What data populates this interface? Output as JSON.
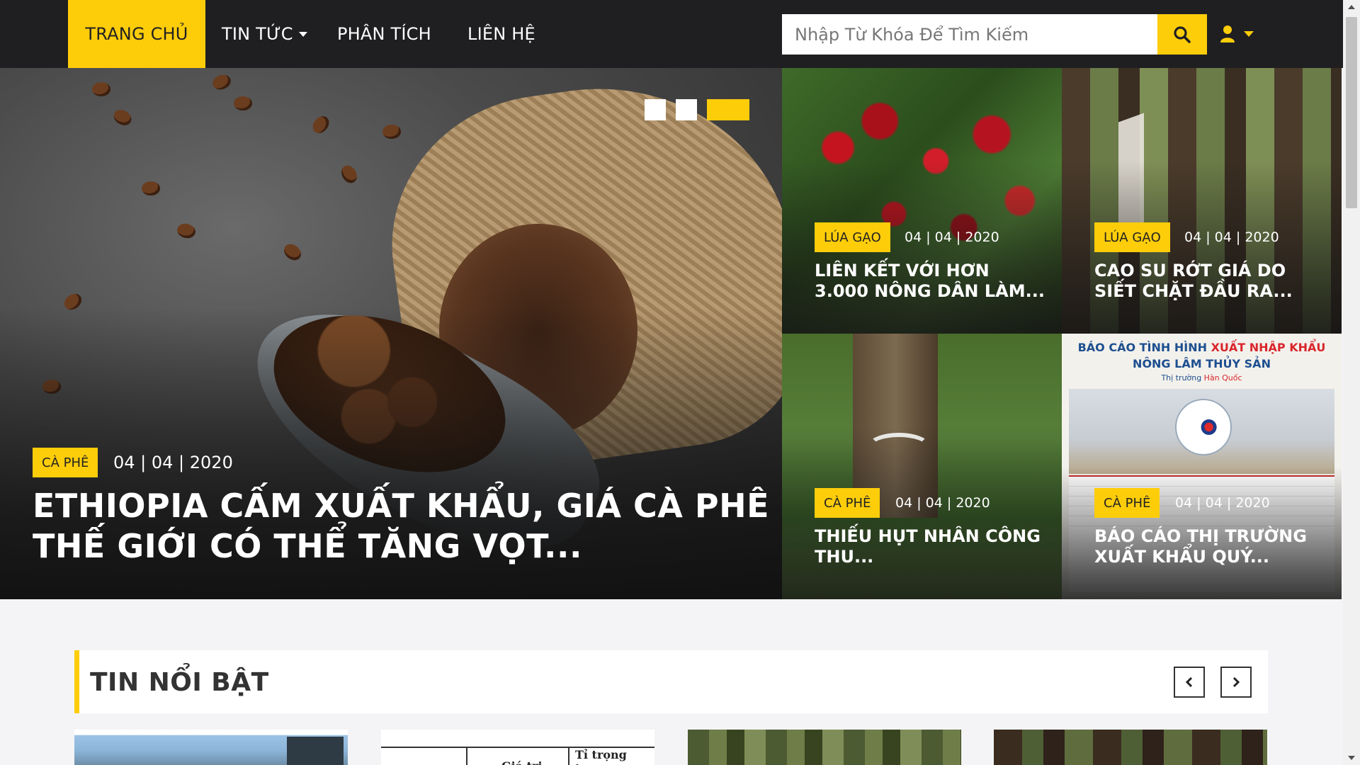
{
  "nav": {
    "items": [
      {
        "label": "TRANG CHỦ",
        "active": true
      },
      {
        "label": "TIN TỨC",
        "dropdown": true
      },
      {
        "label": "PHÂN TÍCH"
      },
      {
        "label": "LIÊN HỆ"
      }
    ],
    "search_placeholder": "Nhập Từ Khóa Để Tìm Kiếm",
    "search_icon": "search-icon",
    "user_icon": "user-icon"
  },
  "hero": {
    "main": {
      "tag": "CÀ PHÊ",
      "date": "04 | 04 | 2020",
      "title": "ETHIOPIA CẤM XUẤT KHẨU, GIÁ CÀ PHÊ THẾ GIỚI CÓ THỂ TĂNG VỌT..."
    },
    "tiles": [
      {
        "tag": "LÚA GẠO",
        "date": "04 | 04 | 2020",
        "title": "LIÊN KẾT VỚI HƠN 3.000 NÔNG DÂN LÀM..."
      },
      {
        "tag": "LÚA GẠO",
        "date": "04 | 04 | 2020",
        "title": "CAO SU RỚT GIÁ DO SIẾT CHẶT ĐẦU RA..."
      },
      {
        "tag": "CÀ PHÊ",
        "date": "04 | 04 | 2020",
        "title": "THIẾU HỤT NHÂN CÔNG THU..."
      },
      {
        "tag": "CÀ PHÊ",
        "date": "04 | 04 | 2020",
        "title": "BÁO CÁO THỊ TRƯỜNG XUẤT KHẨU QUÝ..."
      }
    ],
    "report_image": {
      "line1_a": "BÁO CÁO TÌNH HÌNH ",
      "line1_b": "XUẤT NHẬP KHẨU",
      "line2": "NÔNG LÂM THỦY SẢN",
      "line3_a": "Thị trường ",
      "line3_b": "Hàn Quốc"
    }
  },
  "featured": {
    "title": "TIN NỔI BẬT",
    "prev_icon": "chevron-left-icon",
    "next_icon": "chevron-right-icon",
    "thumb2_labels": {
      "col1": "Giá trị",
      "col2": "Tỉ trọng trong"
    }
  },
  "colors": {
    "accent": "#fecd0a",
    "navbar": "#1f1f22",
    "background": "#f4f4f6"
  }
}
